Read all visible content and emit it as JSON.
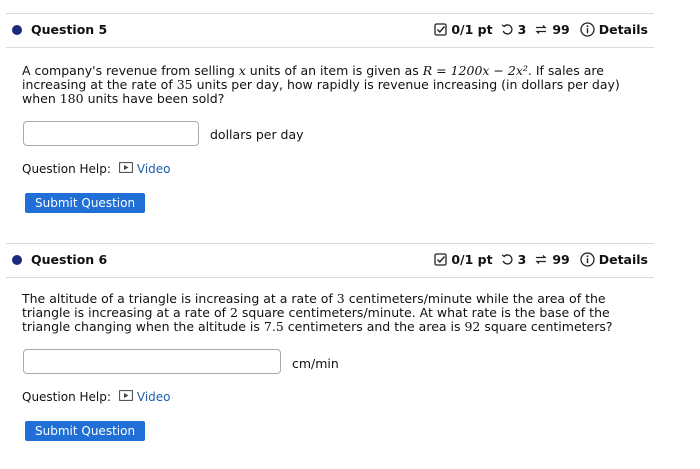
{
  "questions": [
    {
      "title": "Question 5",
      "score": "0/1 pt",
      "retries": "3",
      "attempts": "99",
      "details": "Details",
      "stem": {
        "t1": "A company's revenue from selling ",
        "var_x": "x",
        "t2": " units of an item is given as ",
        "formula": "R = 1200x − 2x²",
        "t3": ". If sales are increasing at the rate of ",
        "n1": "35",
        "t4": " units per day, how rapidly is revenue increasing (in dollars per day) when ",
        "n2": "180",
        "t5": " units have been sold?"
      },
      "answer_value": "",
      "unit": "dollars per day",
      "help_label": "Question Help:",
      "video_label": "Video",
      "submit_label": "Submit Question"
    },
    {
      "title": "Question 6",
      "score": "0/1 pt",
      "retries": "3",
      "attempts": "99",
      "details": "Details",
      "stem": {
        "t1": "The altitude of a triangle is increasing at a rate of ",
        "n1": "3",
        "t2": " centimeters/minute while the area of the triangle is increasing at a rate of ",
        "n2": "2",
        "t3": " square centimeters/minute. At what rate is the base of the triangle changing when the altitude is ",
        "n3": "7.5",
        "t4": " centimeters and the area is ",
        "n4": "92",
        "t5": " square centimeters?"
      },
      "answer_value": "",
      "unit": "cm/min",
      "help_label": "Question Help:",
      "video_label": "Video",
      "submit_label": "Submit Question"
    }
  ],
  "colors": {
    "accent": "#1f6fd6",
    "link": "#1f5da8",
    "bullet": "#1c2a7a"
  },
  "icons": [
    "checkbox-score-icon",
    "retry-icon",
    "attempts-icon",
    "info-icon",
    "video-play-icon"
  ]
}
